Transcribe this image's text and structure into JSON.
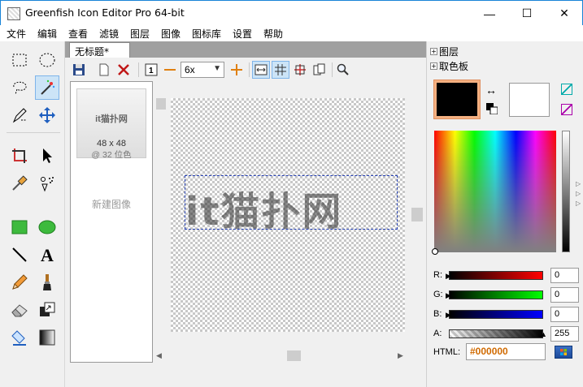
{
  "window": {
    "title": "Greenfish Icon Editor Pro 64-bit",
    "minimize": "—",
    "maximize": "☐",
    "close": "✕"
  },
  "menu": [
    "文件",
    "编辑",
    "查看",
    "滤镜",
    "图层",
    "图像",
    "图标库",
    "设置",
    "帮助"
  ],
  "tools": [
    "rect-select",
    "ellipse-select",
    "lasso-select",
    "magic-wand",
    "pen-select",
    "move",
    "crop",
    "pointer",
    "color-picker",
    "spray",
    "rectangle",
    "ellipse",
    "line",
    "text",
    "pencil",
    "brush",
    "eraser",
    "clone",
    "fill",
    "gradient"
  ],
  "document": {
    "tab_title": "无标题*",
    "zoom": "6x",
    "canvas_text": "it猫扑网"
  },
  "image_list": {
    "thumb_name": "it猫扑网",
    "thumb_size": "48 x 48",
    "thumb_depth": "@ 32 位色",
    "new_image": "新建图像"
  },
  "panels": {
    "layers": "图层",
    "color_picker": "取色板"
  },
  "colors": {
    "primary": "#000000",
    "secondary": "#ffffff"
  },
  "channels": {
    "r_label": "R:",
    "g_label": "G:",
    "b_label": "B:",
    "a_label": "A:",
    "r": "0",
    "g": "0",
    "b": "0",
    "a": "255"
  },
  "html": {
    "label": "HTML:",
    "value": "#000000"
  }
}
